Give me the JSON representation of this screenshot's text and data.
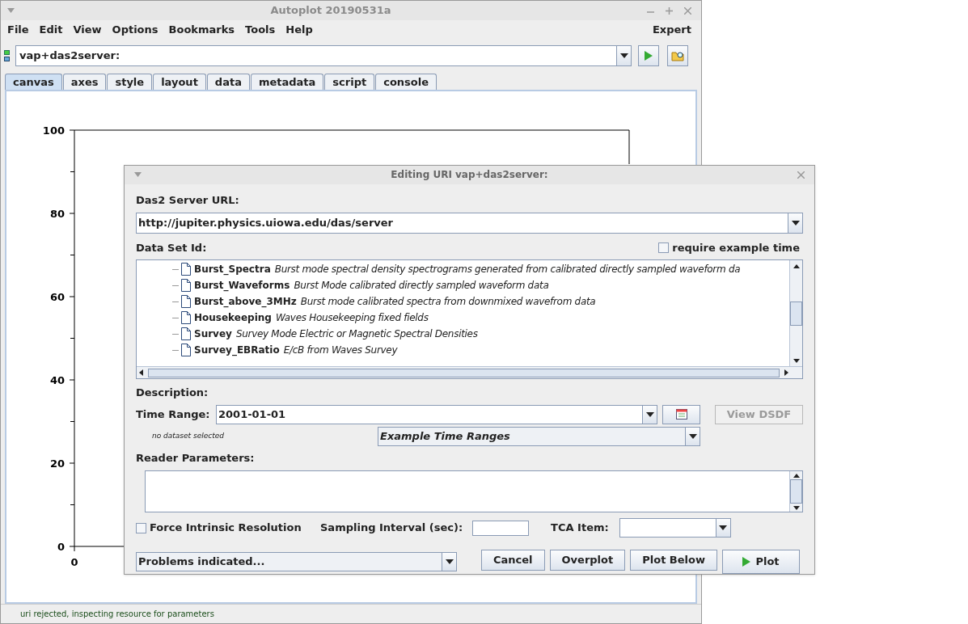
{
  "window": {
    "title": "Autoplot 20190531a"
  },
  "menu": [
    "File",
    "Edit",
    "View",
    "Options",
    "Bookmarks",
    "Tools",
    "Help"
  ],
  "menu_right": "Expert",
  "uri": {
    "value": "vap+das2server:"
  },
  "tabs": [
    {
      "label": "canvas",
      "selected": true
    },
    {
      "label": "axes",
      "selected": false
    },
    {
      "label": "style",
      "selected": false
    },
    {
      "label": "layout",
      "selected": false
    },
    {
      "label": "data",
      "selected": false
    },
    {
      "label": "metadata",
      "selected": false
    },
    {
      "label": "script",
      "selected": false
    },
    {
      "label": "console",
      "selected": false
    }
  ],
  "plot": {
    "y_ticks": [
      "100",
      "80",
      "60",
      "40",
      "20",
      "0"
    ],
    "x_ticks": [
      "0"
    ]
  },
  "status_bar": "uri rejected, inspecting resource for parameters",
  "dialog": {
    "title": "Editing URI vap+das2server:",
    "server_label": "Das2 Server URL:",
    "server_url": "http://jupiter.physics.uiowa.edu/das/server",
    "dataset_label": "Data Set Id:",
    "require_example": {
      "label": "require example time",
      "checked": false
    },
    "datasets": [
      {
        "name": "Burst_Spectra",
        "description": "Burst mode spectral density spectrograms generated from calibrated directly sampled waveform da"
      },
      {
        "name": "Burst_Waveforms",
        "description": "Burst Mode calibrated directly sampled waveform data"
      },
      {
        "name": "Burst_above_3MHz",
        "description": "Burst mode calibrated spectra from downmixed wavefrom data"
      },
      {
        "name": "Housekeeping",
        "description": "Waves Housekeeping fixed fields"
      },
      {
        "name": "Survey",
        "description": "Survey Mode Electric or Magnetic Spectral Densities"
      },
      {
        "name": "Survey_EBRatio",
        "description": "E/cB from Waves Survey"
      }
    ],
    "description_label": "Description:",
    "time_range_label": "Time Range:",
    "time_range": "2001-01-01",
    "view_dsdf": {
      "label": "View DSDF",
      "disabled": true
    },
    "no_dataset": "no dataset selected",
    "example_ranges": "Example Time Ranges",
    "reader_label": "Reader Parameters:",
    "force": {
      "label": "Force Intrinsic Resolution",
      "checked": false
    },
    "sampling_label": "Sampling Interval (sec):",
    "tca_label": "TCA Item:",
    "problems": "Problems indicated...",
    "buttons": [
      {
        "label": "Cancel",
        "kind": "plain"
      },
      {
        "label": "Overplot",
        "kind": "plain"
      },
      {
        "label": "Plot Below",
        "kind": "plain"
      },
      {
        "label": "Plot",
        "kind": "play"
      }
    ]
  }
}
